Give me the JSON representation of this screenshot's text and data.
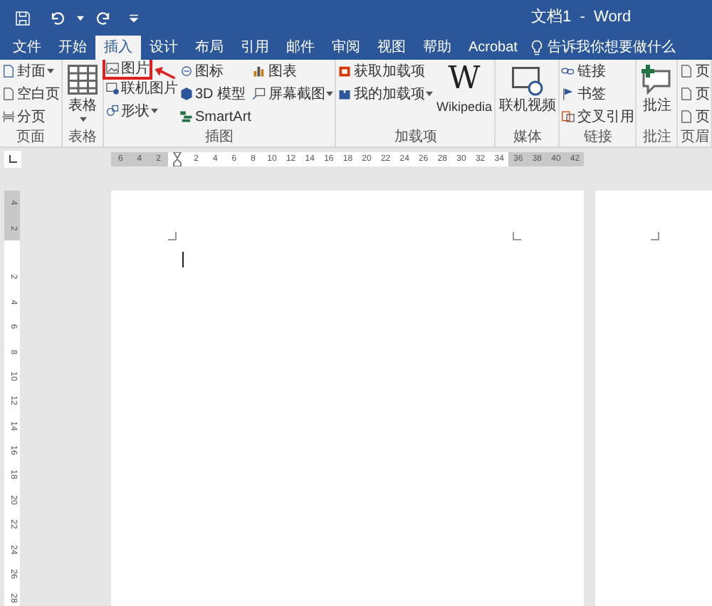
{
  "title_bar": {
    "title": "文档1  -  Word"
  },
  "tabs": [
    {
      "label": "文件",
      "selected": false
    },
    {
      "label": "开始",
      "selected": false
    },
    {
      "label": "插入",
      "selected": true
    },
    {
      "label": "设计",
      "selected": false
    },
    {
      "label": "布局",
      "selected": false
    },
    {
      "label": "引用",
      "selected": false
    },
    {
      "label": "邮件",
      "selected": false
    },
    {
      "label": "审阅",
      "selected": false
    },
    {
      "label": "视图",
      "selected": false
    },
    {
      "label": "帮助",
      "selected": false
    },
    {
      "label": "Acrobat",
      "selected": false
    }
  ],
  "tell_me": {
    "label": "告诉我你想要做什么"
  },
  "groups": [
    {
      "label": "页面",
      "columns": [
        [
          {
            "label": "封面",
            "kind": "small",
            "dropdown": true,
            "highlighted": false
          },
          {
            "label": "空白页",
            "kind": "small",
            "dropdown": false,
            "highlighted": false
          },
          {
            "label": "分页",
            "kind": "small",
            "dropdown": false,
            "highlighted": false
          }
        ]
      ]
    },
    {
      "label": "表格",
      "columns": [
        [
          {
            "label": "表格",
            "kind": "large",
            "dropdown": true,
            "highlighted": false
          }
        ]
      ]
    },
    {
      "label": "插图",
      "columns": [
        [
          {
            "label": "图片",
            "kind": "small",
            "dropdown": false,
            "highlighted": true
          },
          {
            "label": "联机图片",
            "kind": "small",
            "dropdown": false,
            "highlighted": false
          },
          {
            "label": "形状",
            "kind": "small",
            "dropdown": true,
            "highlighted": false
          }
        ],
        [
          {
            "label": "图标",
            "kind": "small",
            "dropdown": false,
            "highlighted": false
          },
          {
            "label": "3D 模型",
            "kind": "small",
            "dropdown": false,
            "highlighted": false
          },
          {
            "label": "SmartArt",
            "kind": "small",
            "dropdown": false,
            "highlighted": false
          }
        ],
        [
          {
            "label": "图表",
            "kind": "small",
            "dropdown": false,
            "highlighted": false
          },
          {
            "label": "屏幕截图",
            "kind": "small",
            "dropdown": true,
            "highlighted": false
          }
        ]
      ]
    },
    {
      "label": "加载项",
      "columns": [
        [
          {
            "label": "获取加载项",
            "kind": "small",
            "dropdown": false,
            "highlighted": false
          },
          {
            "label": "我的加载项",
            "kind": "small",
            "dropdown": true,
            "highlighted": false
          }
        ],
        [
          {
            "label": "Wikipedia",
            "logo": "W",
            "kind": "large",
            "dropdown": false,
            "highlighted": false
          }
        ]
      ]
    },
    {
      "label": "媒体",
      "columns": [
        [
          {
            "label": "联机视频",
            "kind": "large",
            "dropdown": false,
            "highlighted": false
          }
        ]
      ]
    },
    {
      "label": "链接",
      "columns": [
        [
          {
            "label": "链接",
            "kind": "small",
            "dropdown": false,
            "highlighted": false
          },
          {
            "label": "书签",
            "kind": "small",
            "dropdown": false,
            "highlighted": false
          },
          {
            "label": "交叉引用",
            "kind": "small",
            "dropdown": false,
            "highlighted": false
          }
        ]
      ]
    },
    {
      "label": "批注",
      "columns": [
        [
          {
            "label": "批注",
            "kind": "large",
            "dropdown": false,
            "highlighted": false
          }
        ]
      ]
    },
    {
      "label": "页眉",
      "columns": [
        [
          {
            "label": "页",
            "kind": "small",
            "dropdown": false,
            "highlighted": false
          },
          {
            "label": "页",
            "kind": "small",
            "dropdown": false,
            "highlighted": false
          },
          {
            "label": "页",
            "kind": "small",
            "dropdown": false,
            "highlighted": false
          }
        ]
      ]
    }
  ],
  "horizontal_ruler": [
    {
      "kind": "number",
      "label": "6",
      "margin": true
    },
    {
      "kind": "number",
      "label": "4",
      "margin": true
    },
    {
      "kind": "number",
      "label": "2",
      "margin": true
    },
    {
      "kind": "marker",
      "margin": false
    },
    {
      "kind": "number",
      "label": "2",
      "margin": false
    },
    {
      "kind": "number",
      "label": "4",
      "margin": false
    },
    {
      "kind": "number",
      "label": "6",
      "margin": false
    },
    {
      "kind": "number",
      "label": "8",
      "margin": false
    },
    {
      "kind": "number",
      "label": "10",
      "margin": false
    },
    {
      "kind": "number",
      "label": "12",
      "margin": false
    },
    {
      "kind": "number",
      "label": "14",
      "margin": false
    },
    {
      "kind": "number",
      "label": "16",
      "margin": false
    },
    {
      "kind": "number",
      "label": "18",
      "margin": false
    },
    {
      "kind": "number",
      "label": "20",
      "margin": false
    },
    {
      "kind": "number",
      "label": "22",
      "margin": false
    },
    {
      "kind": "number",
      "label": "24",
      "margin": false
    },
    {
      "kind": "number",
      "label": "26",
      "margin": false
    },
    {
      "kind": "number",
      "label": "28",
      "margin": false
    },
    {
      "kind": "number",
      "label": "30",
      "margin": false
    },
    {
      "kind": "number",
      "label": "32",
      "margin": false
    },
    {
      "kind": "number",
      "label": "34",
      "margin": false
    },
    {
      "kind": "number",
      "label": "36",
      "margin": true
    },
    {
      "kind": "number",
      "label": "38",
      "margin": true
    },
    {
      "kind": "number",
      "label": "40",
      "margin": true
    },
    {
      "kind": "number",
      "label": "42",
      "margin": true
    }
  ],
  "vertical_ruler": [
    {
      "kind": "number",
      "label": "4",
      "margin": true
    },
    {
      "kind": "number",
      "label": "2",
      "margin": true
    },
    {
      "kind": "gap",
      "margin": false
    },
    {
      "kind": "number",
      "label": "2",
      "margin": false
    },
    {
      "kind": "number",
      "label": "4",
      "margin": false
    },
    {
      "kind": "number",
      "label": "6",
      "margin": false
    },
    {
      "kind": "number",
      "label": "8",
      "margin": false
    },
    {
      "kind": "number",
      "label": "10",
      "margin": false
    },
    {
      "kind": "number",
      "label": "12",
      "margin": false
    },
    {
      "kind": "number",
      "label": "14",
      "margin": false
    },
    {
      "kind": "number",
      "label": "16",
      "margin": false
    },
    {
      "kind": "number",
      "label": "18",
      "margin": false
    },
    {
      "kind": "number",
      "label": "20",
      "margin": false
    },
    {
      "kind": "number",
      "label": "22",
      "margin": false
    },
    {
      "kind": "number",
      "label": "24",
      "margin": false
    },
    {
      "kind": "number",
      "label": "26",
      "margin": false
    },
    {
      "kind": "number",
      "label": "28",
      "margin": false
    }
  ]
}
